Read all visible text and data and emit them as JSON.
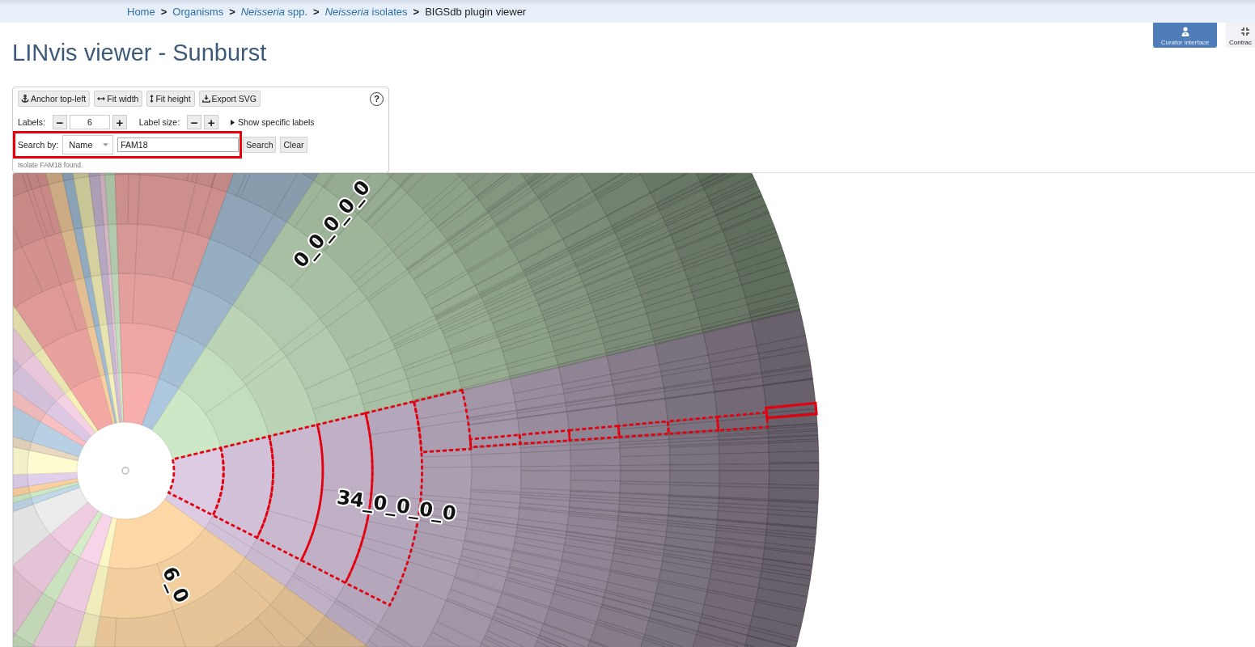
{
  "breadcrumb": [
    {
      "kind": "link",
      "text": "Home"
    },
    {
      "kind": "separator",
      "text": ">"
    },
    {
      "kind": "link",
      "text": "Organisms"
    },
    {
      "kind": "separator",
      "text": ">"
    },
    {
      "kind": "link",
      "text": "*Neisseria* spp."
    },
    {
      "kind": "separator",
      "text": ">"
    },
    {
      "kind": "link",
      "text": "*Neisseria* isolates"
    },
    {
      "kind": "separator",
      "text": ">"
    },
    {
      "kind": "current",
      "text": "BIGSdb plugin viewer"
    }
  ],
  "header_buttons": [
    {
      "kind": "curator",
      "label": "Curator interface"
    },
    {
      "kind": "contract",
      "label": "Contrac"
    }
  ],
  "title": "LINvis viewer - Sunburst",
  "toolbar": {
    "buttons": [
      {
        "kind": "anchor",
        "label": "Anchor top-left"
      },
      {
        "kind": "fit-width",
        "label": "Fit width"
      },
      {
        "kind": "fit-height",
        "label": "Fit height"
      },
      {
        "kind": "export",
        "label": "Export SVG"
      }
    ],
    "help": "?"
  },
  "labels_control": {
    "label": "Labels:",
    "decrement": "−",
    "value": "6",
    "increment": "+"
  },
  "label_size_control": {
    "label": "Label size:",
    "decrement": "−",
    "increment": "+"
  },
  "specific_labels": {
    "label": "Show specific labels",
    "expanded": false
  },
  "search": {
    "emphasized": true,
    "label": "Search by:",
    "field": "Name",
    "value": "FAM18",
    "buttons": [
      "Search",
      "Clear"
    ],
    "status": "Isolate FAM18 found."
  },
  "sunburst": {
    "labels": [
      "0_0_0_0_0",
      "34_0_0_0_0",
      "6_0"
    ],
    "highlighted": true
  }
}
